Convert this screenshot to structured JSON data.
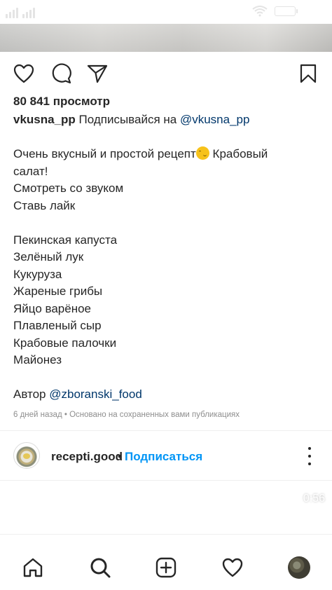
{
  "status_bar": {
    "signal_icon": "signal-bars-icon",
    "wifi_icon": "wifi-icon",
    "battery_icon": "battery-icon"
  },
  "post_actions": {
    "like_icon": "heart-icon",
    "comment_icon": "comment-bubble-icon",
    "share_icon": "send-paper-plane-icon",
    "save_icon": "bookmark-icon"
  },
  "views": "80 841 просмотр",
  "caption": {
    "username": "vkusna_pp",
    "text_before_link": " Подписывайся на ",
    "mention": "@vkusna_pp"
  },
  "body": {
    "line1_text": "Очень вкусный и простой рецепт",
    "line1_emoji": "smirking-face-emoji",
    "line1_after": " Крабовый",
    "line2": "салат!",
    "line3": "Смотреть со звуком",
    "line4": "Ставь лайк",
    "ingredients": [
      "Пекинская капуста",
      "Зелёный лук",
      "Кукуруза",
      "Жареные грибы",
      "Яйцо варёное",
      "Плавленый сыр",
      "Крабовые палочки",
      "Майонез"
    ],
    "author_label": "Автор ",
    "author_mention": "@zboranski_food"
  },
  "meta": "6 дней назад • Основано на сохраненных вами публикациях",
  "next_post": {
    "username": "recepti.good",
    "separator": "•",
    "follow_label": "Подписаться",
    "more_icon": "more-vertical-icon",
    "duration": "0:56"
  },
  "bottom_nav": {
    "home_icon": "home-icon",
    "search_icon": "search-icon",
    "create_icon": "add-post-icon",
    "activity_icon": "heart-icon",
    "profile_icon": "profile-avatar"
  },
  "colors": {
    "link": "#00376b",
    "follow": "#0095f6",
    "meta": "#8e8e8e",
    "text": "#262626"
  }
}
